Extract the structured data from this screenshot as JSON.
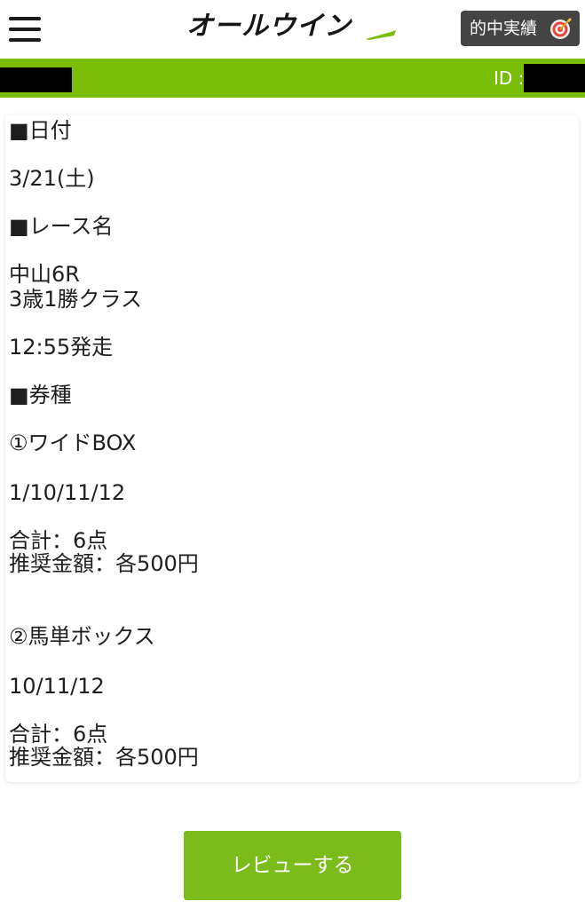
{
  "header": {
    "menu_icon": "hamburger-menu-icon",
    "logo_text": "オールウイン",
    "results_button_label": "的中実績",
    "results_icon": "target-icon"
  },
  "user_bar": {
    "id_label": "ID :"
  },
  "colors": {
    "brand_green": "#79bd08",
    "button_green": "#7bbb1a",
    "results_button_bg": "#444444"
  },
  "card": {
    "date_heading": "■日付",
    "date_value": "3/21(土)",
    "race_heading": "■レース名",
    "race_venue": "中山6R",
    "race_class": "3歳1勝クラス",
    "post_time": "12:55発走",
    "ticket_heading": "■券種",
    "bets": [
      {
        "title": "①ワイドBOX",
        "numbers": "1/10/11/12",
        "total": "合計：6点",
        "recommended": "推奨金額：各500円"
      },
      {
        "title": "②馬単ボックス",
        "numbers": "10/11/12",
        "total": "合計：6点",
        "recommended": "推奨金額：各500円"
      }
    ]
  },
  "review_button_label": "レビューする"
}
